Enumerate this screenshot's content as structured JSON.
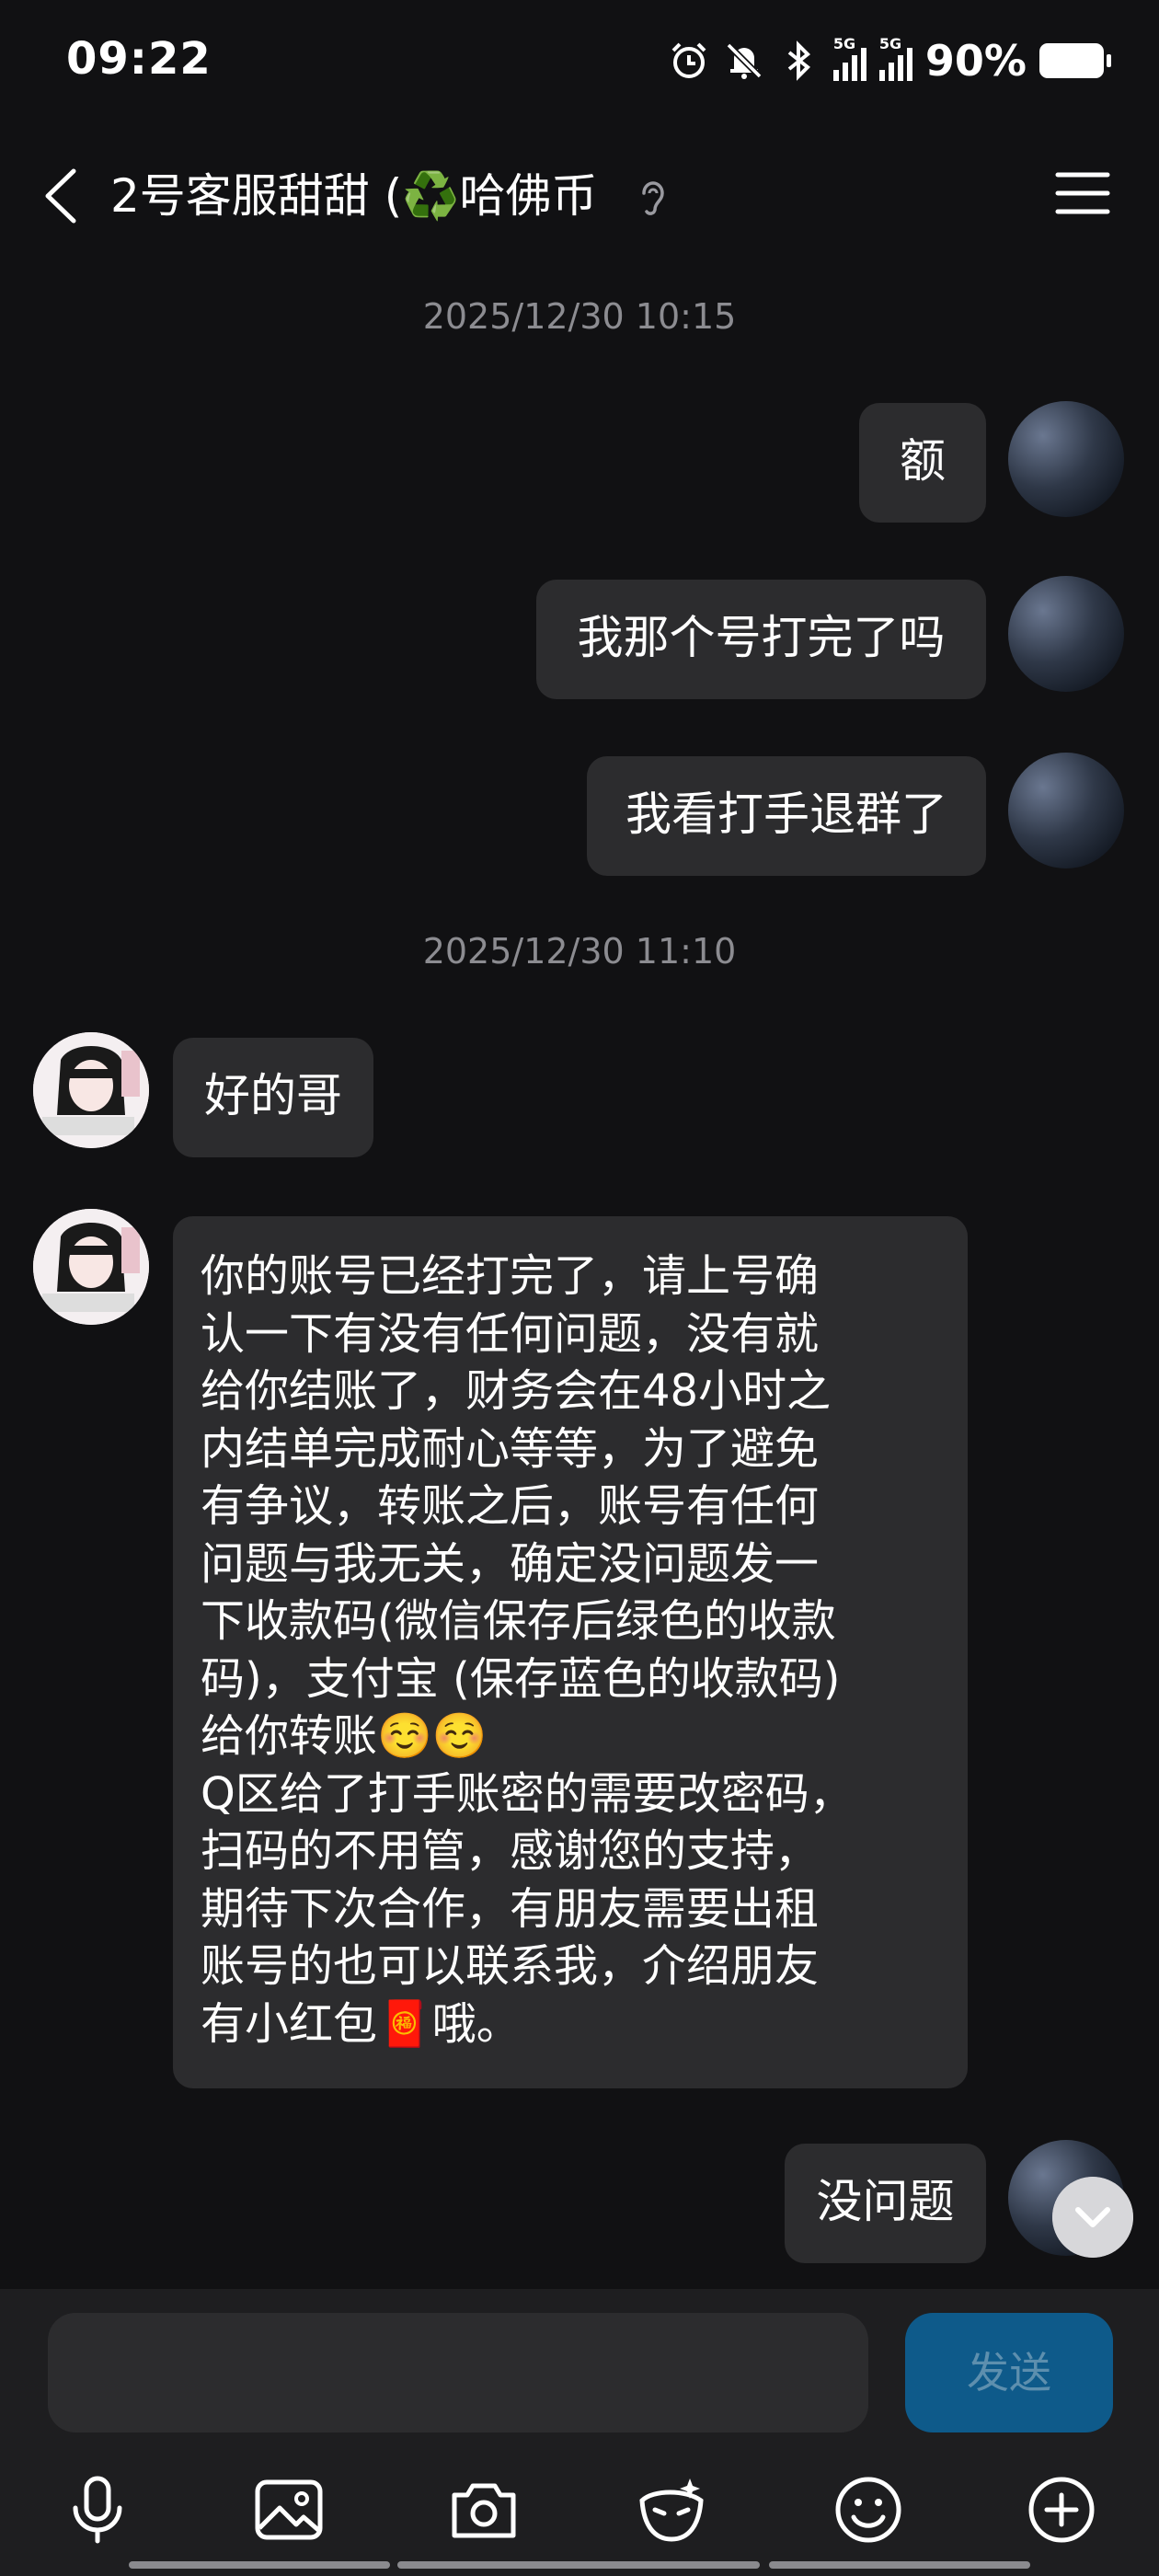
{
  "status_bar": {
    "time": "09:22",
    "network_tag_1": "5G",
    "network_tag_2": "5G",
    "battery": "90%",
    "icons": [
      "alarm-icon",
      "mute-icon",
      "bluetooth-icon",
      "signal-icon",
      "signal-icon",
      "battery-icon"
    ]
  },
  "header": {
    "title": "2号客服甜甜 (♻️哈佛币",
    "icons": [
      "back-icon",
      "ear-icon",
      "menu-icon"
    ]
  },
  "chat": {
    "timestamp_1": "2025/12/30 10:15",
    "timestamp_2": "2025/12/30 11:10",
    "messages": [
      {
        "from": "me",
        "text": "额"
      },
      {
        "from": "me",
        "text": "我那个号打完了吗"
      },
      {
        "from": "me",
        "text": "我看打手退群了"
      },
      {
        "from": "them",
        "text": "好的哥"
      },
      {
        "from": "them",
        "text": "你的账号已经打完了，请上号确\n认一下有没有任何问题，没有就\n给你结账了，财务会在48小时之\n内结单完成耐心等等，为了避免\n有争议，转账之后，账号有任何\n问题与我无关，确定没问题发一\n下收款码(微信保存后绿色的收款\n码)，支付宝 (保存蓝色的收款码)\n给你转账☺️☺️\nQ区给了打手账密的需要改密码，\n扫码的不用管，感谢您的支持，\n期待下次合作，有朋友需要出租\n账号的也可以联系我，介绍朋友\n有小红包🧧哦。"
      },
      {
        "from": "me",
        "text": "没问题"
      }
    ]
  },
  "input_bar": {
    "send_label": "发送",
    "tools": [
      "microphone-icon",
      "image-icon",
      "camera-icon",
      "magic-face-icon",
      "emoji-icon",
      "plus-icon"
    ]
  }
}
